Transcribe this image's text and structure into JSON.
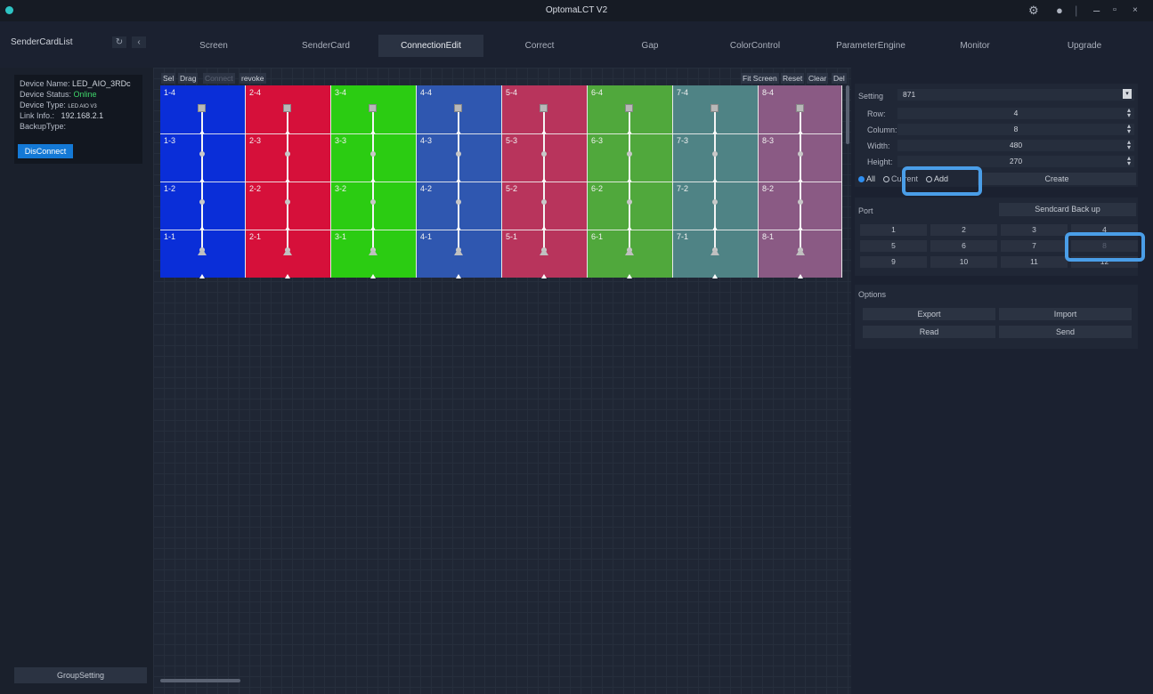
{
  "app": {
    "title": "OptomaLCT V2",
    "controls": [
      "settings-icon",
      "user-icon",
      "minimize-icon",
      "restore-icon",
      "close-icon"
    ]
  },
  "sender_card_list": {
    "title": "SenderCardList",
    "refresh_icon": "↻",
    "collapse_icon": "‹"
  },
  "tabs": [
    {
      "label": "Screen"
    },
    {
      "label": "SenderCard"
    },
    {
      "label": "ConnectionEdit",
      "active": true
    },
    {
      "label": "Correct"
    },
    {
      "label": "Gap"
    },
    {
      "label": "ColorControl"
    },
    {
      "label": "ParameterEngine"
    },
    {
      "label": "Monitor"
    },
    {
      "label": "Upgrade"
    }
  ],
  "device": {
    "name_label": "Device Name:",
    "name": "LED_AIO_3RDc",
    "status_label": "Device Status:",
    "status": "Online",
    "type_label": "Device Type:",
    "type": "LED AIO V3",
    "link_label": "Link Info.:",
    "link": "192.168.2.1",
    "backup_label": "BackupType:",
    "disconnect_label": "DisConnect"
  },
  "group_setting_label": "GroupSetting",
  "toolbar": {
    "sel": "Sel",
    "drag": "Drag",
    "connect": "Connect",
    "revoke": "revoke",
    "fit_screen": "Fit Screen",
    "reset": "Reset",
    "clear": "Clear",
    "del": "Del"
  },
  "grid": {
    "columns": [
      {
        "color": "#0a2ed8",
        "cells": [
          "1-4",
          "1-3",
          "1-2",
          "1-1"
        ]
      },
      {
        "color": "#d6103a",
        "cells": [
          "2-4",
          "2-3",
          "2-2",
          "2-1"
        ]
      },
      {
        "color": "#2bcc12",
        "cells": [
          "3-4",
          "3-3",
          "3-2",
          "3-1"
        ]
      },
      {
        "color": "#2f57b0",
        "cells": [
          "4-4",
          "4-3",
          "4-2",
          "4-1"
        ]
      },
      {
        "color": "#b8345c",
        "cells": [
          "5-4",
          "5-3",
          "5-2",
          "5-1"
        ]
      },
      {
        "color": "#50a83c",
        "cells": [
          "6-4",
          "6-3",
          "6-2",
          "6-1"
        ]
      },
      {
        "color": "#4f8385",
        "cells": [
          "7-4",
          "7-3",
          "7-2",
          "7-1"
        ]
      },
      {
        "color": "#8a5a84",
        "cells": [
          "8-4",
          "8-3",
          "8-2",
          "8-1"
        ]
      }
    ]
  },
  "setting": {
    "label": "Setting",
    "value": "871",
    "row_label": "Row:",
    "row": "4",
    "column_label": "Column:",
    "column": "8",
    "width_label": "Width:",
    "width": "480",
    "height_label": "Height:",
    "height": "270",
    "mode_all": "All",
    "mode_current": "Current",
    "mode_add": "Add",
    "create_label": "Create"
  },
  "port": {
    "label": "Port",
    "backup_label": "Sendcard Back up",
    "buttons": [
      "1",
      "2",
      "3",
      "4",
      "5",
      "6",
      "7",
      "8",
      "9",
      "10",
      "11",
      "12"
    ]
  },
  "options": {
    "label": "Options",
    "export": "Export",
    "import": "Import",
    "read": "Read",
    "send": "Send"
  }
}
